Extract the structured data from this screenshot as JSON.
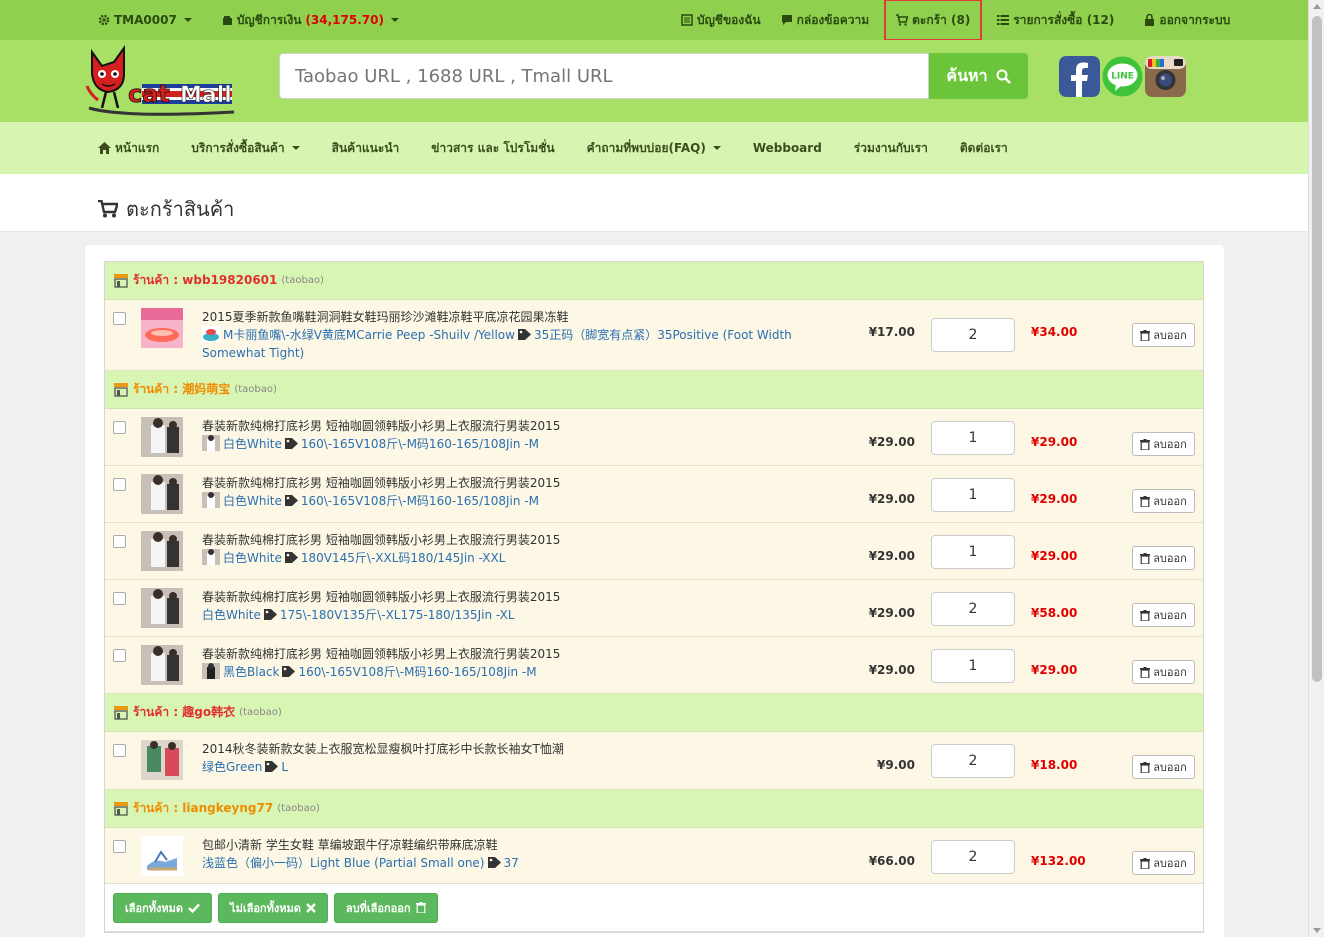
{
  "topbar": {
    "user": "TMA0007",
    "account_label": "บัญชีการเงิน",
    "account_balance": "(34,175.70)",
    "my_account": "บัญชีของฉัน",
    "inbox": "กล่องข้อความ",
    "cart": "ตะกร้า (8)",
    "orders": "รายการสั่งซื้อ (12)",
    "logout": "ออกจากระบบ"
  },
  "header": {
    "search_placeholder": "Taobao URL , 1688 URL , Tmall URL",
    "search_button": "ค้นหา"
  },
  "nav": [
    "หน้าแรก",
    "บริการสั่งซื้อสินค้า",
    "สินค้าแนะนำ",
    "ข่าวสาร และ โปรโมชั่น",
    "คำถามที่พบบ่อย(FAQ)",
    "Webboard",
    "ร่วมงานกับเรา",
    "ติดต่อเรา"
  ],
  "page_title": "ตะกร้าสินค้า",
  "delete_label": "ลบออก",
  "shops": [
    {
      "label": "ร้านค้า : wbb19820601",
      "source": "(taobao)",
      "items": [
        {
          "name": "2015夏季新款鱼嘴鞋洞洞鞋女鞋玛丽珍沙滩鞋凉鞋平底凉花园果冻鞋",
          "color": "M卡丽鱼嘴\\-水绿V黄底MCarrie Peep -Shuilv /Yellow",
          "size": "35正码（脚宽有点紧）35Positive (Foot Width Somewhat Tight)",
          "price": "¥17.00",
          "qty": "2",
          "total": "¥34.00"
        }
      ]
    },
    {
      "label": "ร้านค้า : 潮妈萌宝",
      "source": "(taobao)",
      "items": [
        {
          "name": "春装新款纯棉打底衫男 短袖咖圆领韩版小衫男上衣服流行男装2015",
          "color": "白色White",
          "size": "160\\-165V108斤\\-M码160-165/108Jin -M",
          "price": "¥29.00",
          "qty": "1",
          "total": "¥29.00"
        },
        {
          "name": "春装新款纯棉打底衫男 短袖咖圆领韩版小衫男上衣服流行男装2015",
          "color": "白色White",
          "size": "160\\-165V108斤\\-M码160-165/108Jin -M",
          "price": "¥29.00",
          "qty": "1",
          "total": "¥29.00"
        },
        {
          "name": "春装新款纯棉打底衫男 短袖咖圆领韩版小衫男上衣服流行男装2015",
          "color": "白色White",
          "size": "180V145斤\\-XXL码180/145Jin -XXL",
          "price": "¥29.00",
          "qty": "1",
          "total": "¥29.00"
        },
        {
          "name": "春装新款纯棉打底衫男 短袖咖圆领韩版小衫男上衣服流行男装2015",
          "color": "白色White",
          "size": "175\\-180V135斤\\-XL175-180/135Jin -XL",
          "price": "¥29.00",
          "qty": "2",
          "total": "¥58.00"
        },
        {
          "name": "春装新款纯棉打底衫男 短袖咖圆领韩版小衫男上衣服流行男装2015",
          "color": "黑色Black",
          "size": "160\\-165V108斤\\-M码160-165/108Jin -M",
          "price": "¥29.00",
          "qty": "1",
          "total": "¥29.00"
        }
      ]
    },
    {
      "label": "ร้านค้า : 趣go韩衣",
      "source": "(taobao)",
      "items": [
        {
          "name": "2014秋冬装新款女装上衣服宽松显瘦枫叶打底衫中长款长袖女T恤潮",
          "color": "绿色Green",
          "size": "L",
          "price": "¥9.00",
          "qty": "2",
          "total": "¥18.00"
        }
      ]
    },
    {
      "label": "ร้านค้า : liangkeyng77",
      "source": "(taobao)",
      "items": [
        {
          "name": "包邮小清新 学生女鞋 草编坡跟牛仔凉鞋编织带麻底凉鞋",
          "color": "浅蓝色（偏小一码）Light Blue (Partial Small one)",
          "size": "37",
          "price": "¥66.00",
          "qty": "2",
          "total": "¥132.00"
        }
      ]
    }
  ],
  "actions": {
    "select_all": "เลือกทั้งหมด",
    "deselect_all": "ไม่เลือกทั้งหมด",
    "delete_selected": "ลบที่เลือกออก"
  }
}
